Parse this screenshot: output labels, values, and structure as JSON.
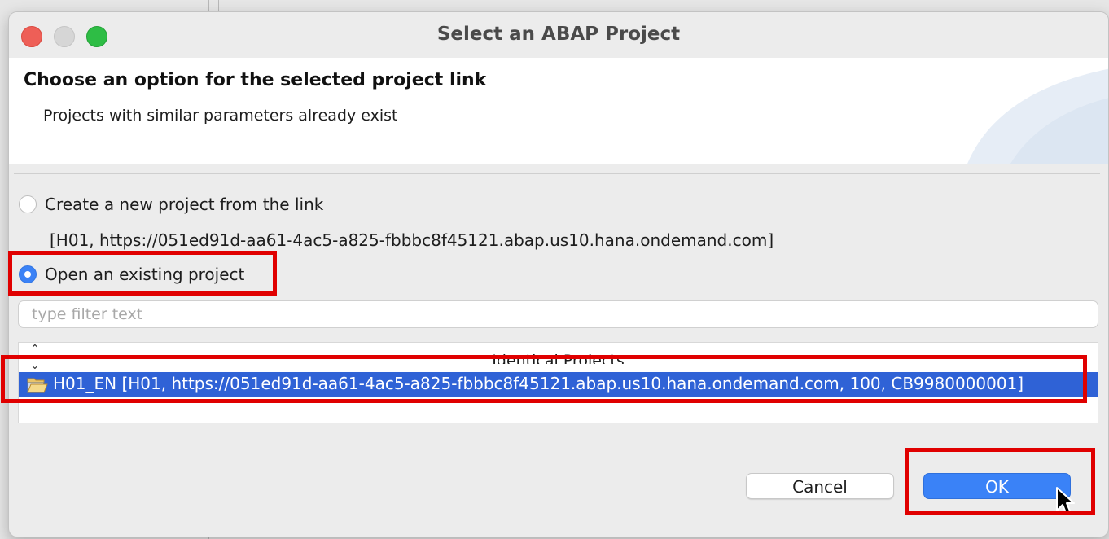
{
  "window": {
    "title": "Select an ABAP Project"
  },
  "header": {
    "title": "Choose an option for the selected project link",
    "description": "Projects with similar parameters already exist"
  },
  "options": {
    "create_new": {
      "label": "Create a new project from the link",
      "selected": false
    },
    "link_info": "[H01, https://051ed91d-aa61-4ac5-a825-fbbbc8f45121.abap.us10.hana.ondemand.com]",
    "open_existing": {
      "label": "Open an existing project",
      "selected": true
    }
  },
  "filter": {
    "placeholder": "type filter text",
    "value": ""
  },
  "projects_tree": {
    "header": "Identical Projects",
    "rows": [
      {
        "icon": "open-folder-icon",
        "label": "H01_EN [H01, https://051ed91d-aa61-4ac5-a825-fbbbc8f45121.abap.us10.hana.ondemand.com, 100, CB9980000001]",
        "selected": true
      }
    ]
  },
  "buttons": {
    "cancel": "Cancel",
    "ok": "OK"
  },
  "colors": {
    "accent": "#3a82f7",
    "selection": "#2f62d6",
    "highlight_annotation": "#e00000"
  }
}
